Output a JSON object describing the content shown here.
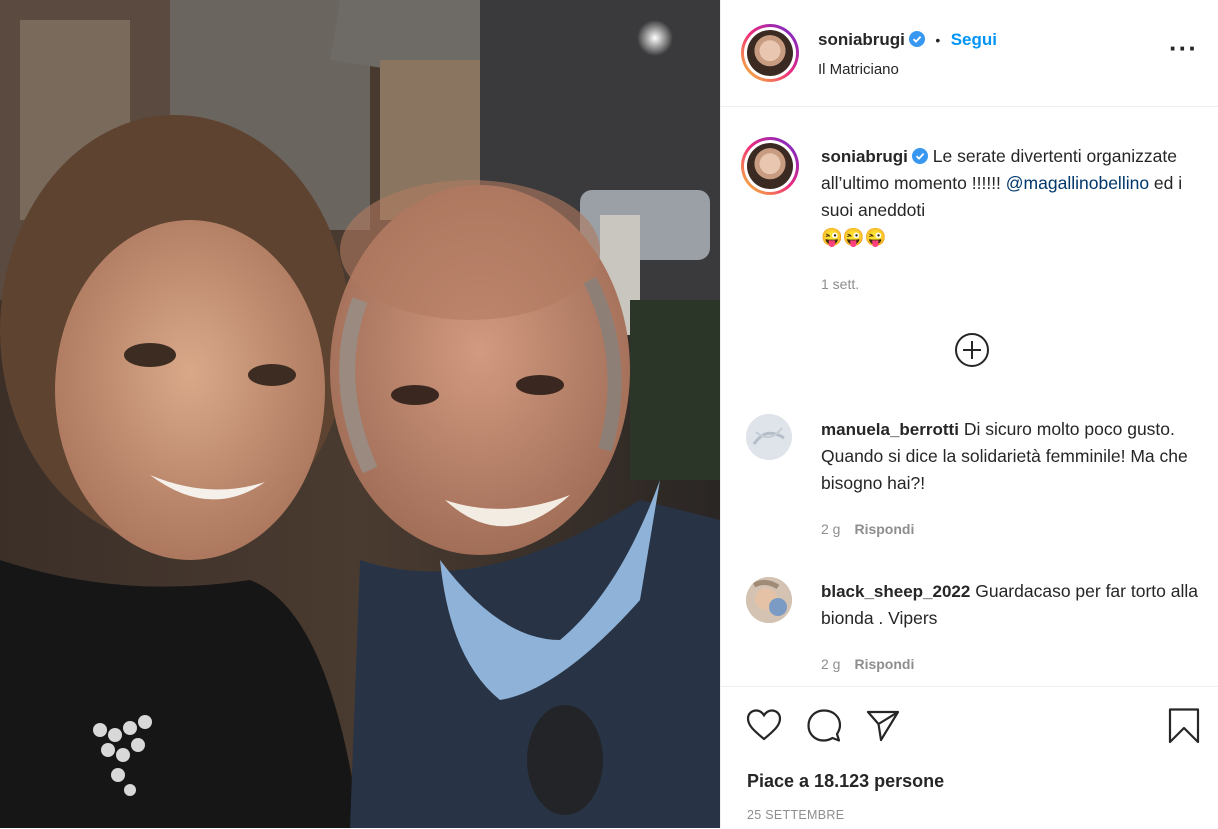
{
  "post": {
    "username": "soniabrugi",
    "follow_label": "Segui",
    "location": "Il Matriciano",
    "more_icon": "more-horizontal-icon"
  },
  "caption": {
    "username": "soniabrugi",
    "text_before": "Le serate divertenti organizzate all’ultimo momento !!!!!!",
    "mention": "@magallinobellino",
    "text_after": " ed i suoi aneddoti",
    "emojis": "😜😜😜",
    "time": "1 sett."
  },
  "load_more_icon": "add-circle-icon",
  "comments": [
    {
      "username": "manuela_berrotti",
      "text": "Di sicuro molto poco gusto. Quando si dice la solidarietà femminile! Ma che bisogno hai?!",
      "time": "2 g",
      "reply_label": "Rispondi"
    },
    {
      "username": "black_sheep_2022",
      "text": "Guardacaso per far torto alla bionda . Vipers",
      "time": "2 g",
      "reply_label": "Rispondi"
    }
  ],
  "likes_text": "Piace a 18.123 persone",
  "date_text": "25 SETTEMBRE",
  "colors": {
    "accent": "#0095f6",
    "mention": "#00376b",
    "muted": "#8e8e8e",
    "text": "#262626"
  }
}
